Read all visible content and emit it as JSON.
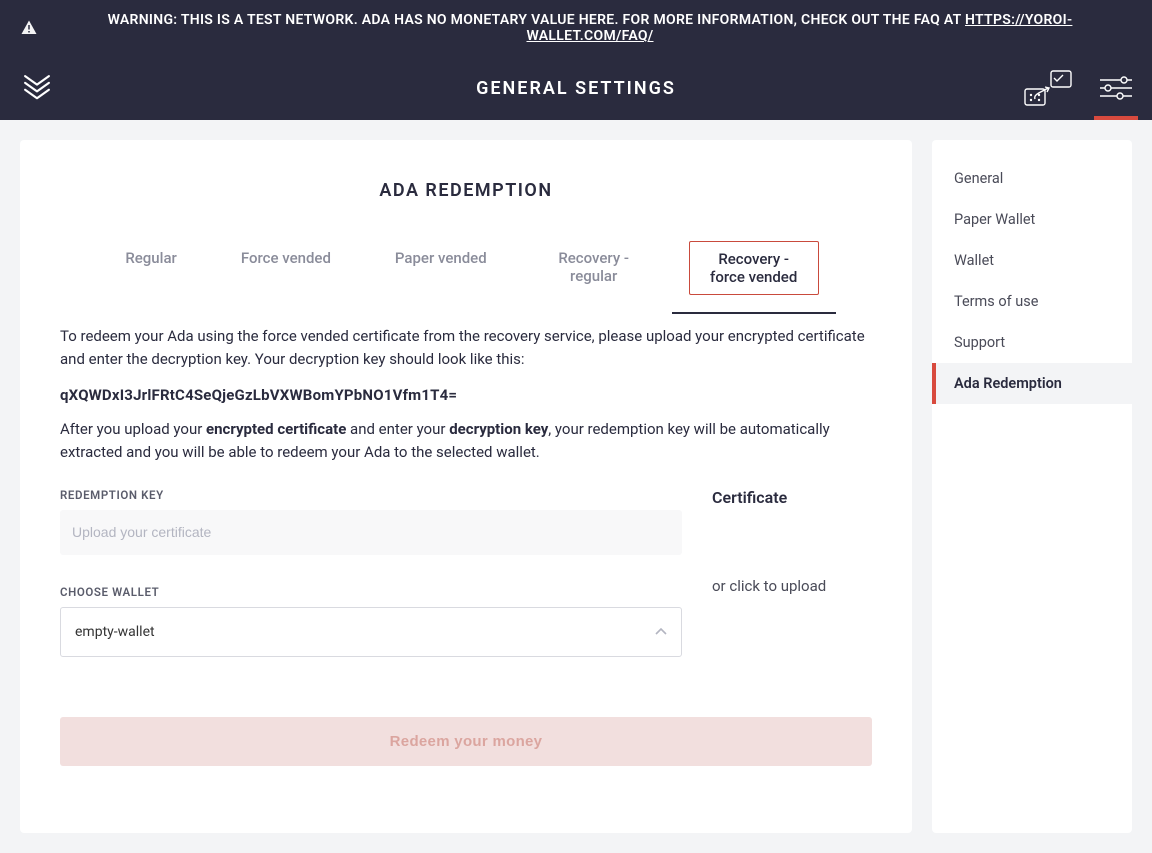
{
  "warning": {
    "prefix": "WARNING: THIS IS A TEST NETWORK. ADA HAS NO MONETARY VALUE HERE. FOR MORE INFORMATION, CHECK OUT THE FAQ AT ",
    "link_text": "HTTPS://YOROI-WALLET.COM/FAQ/"
  },
  "header": {
    "title": "GENERAL SETTINGS"
  },
  "card": {
    "title": "ADA REDEMPTION",
    "tabs": {
      "regular": "Regular",
      "force_vended": "Force vended",
      "paper_vended": "Paper vended",
      "recovery_regular": "Recovery - regular",
      "recovery_force_vended": "Recovery - force vended"
    },
    "desc1": "To redeem your Ada using the force vended certificate from the recovery service, please upload your encrypted certificate and enter the decryption key. Your decryption key should look like this:",
    "code": "qXQWDxI3JrlFRtC4SeQjeGzLbVXWBomYPbNO1Vfm1T4=",
    "desc2_a": "After you upload your ",
    "desc2_b": "encrypted certificate",
    "desc2_c": " and enter your ",
    "desc2_d": "decryption key",
    "desc2_e": ", your redemption key will be automatically extracted and you will be able to redeem your Ada to the selected wallet.",
    "redemption_key_label": "REDEMPTION KEY",
    "redemption_key_placeholder": "Upload your certificate",
    "choose_wallet_label": "CHOOSE WALLET",
    "wallet_selected": "empty-wallet",
    "certificate_label": "Certificate",
    "upload_text": "or click to upload",
    "redeem_button": "Redeem your money"
  },
  "sidebar": {
    "items": {
      "general": "General",
      "paper_wallet": "Paper Wallet",
      "wallet": "Wallet",
      "terms": "Terms of use",
      "support": "Support",
      "ada_redemption": "Ada Redemption"
    }
  }
}
